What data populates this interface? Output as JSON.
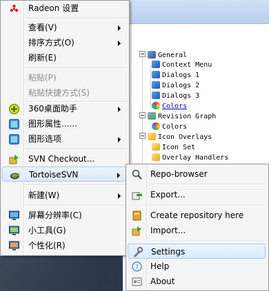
{
  "colors": {
    "menu_bg": "#f5f5f5",
    "menu_border": "#979797",
    "highlight_bg": "#d9eafc",
    "highlight_border": "#a8cbf1",
    "disabled_text": "#8d8d8d",
    "link_text": "#0000cc"
  },
  "settings_tree": {
    "items": [
      {
        "label": "General",
        "icon": "wrench-icon"
      },
      {
        "label": "Context Menu",
        "icon": "puzzle-icon"
      },
      {
        "label": "Dialogs 1",
        "icon": "puzzle-icon"
      },
      {
        "label": "Dialogs 2",
        "icon": "puzzle-icon"
      },
      {
        "label": "Dialogs 3",
        "icon": "puzzle-icon"
      },
      {
        "label": "Colors",
        "icon": "palette-icon"
      },
      {
        "label": "Revision Graph",
        "icon": "graph-icon"
      },
      {
        "label": "Colors",
        "icon": "palette-icon"
      },
      {
        "label": "Icon Overlays",
        "icon": "overlay-icon"
      },
      {
        "label": "Icon Set",
        "icon": "overlay-icon"
      },
      {
        "label": "Overlay Handlers",
        "icon": "overlay-icon"
      }
    ]
  },
  "context_menu": {
    "items": [
      {
        "label": "Radeon 设置",
        "icon": "radeon-icon",
        "disabled": false,
        "submenu": false
      },
      {
        "label": "查看(V)",
        "disabled": false,
        "submenu": true
      },
      {
        "label": "排序方式(O)",
        "disabled": false,
        "submenu": true
      },
      {
        "label": "刷新(E)",
        "disabled": false,
        "submenu": false
      },
      {
        "label": "粘贴(P)",
        "disabled": true,
        "submenu": false
      },
      {
        "label": "粘贴快捷方式(S)",
        "disabled": true,
        "submenu": false
      },
      {
        "label": "360桌面助手",
        "icon": "360-icon",
        "disabled": false,
        "submenu": true
      },
      {
        "label": "图形属性......",
        "icon": "graphics-properties-icon",
        "disabled": false,
        "submenu": false
      },
      {
        "label": "图形选项",
        "icon": "graphics-options-icon",
        "disabled": false,
        "submenu": true
      },
      {
        "label": "SVN Checkout...",
        "icon": "svn-checkout-icon",
        "disabled": false,
        "submenu": false
      },
      {
        "label": "TortoiseSVN",
        "icon": "tortoisesvn-icon",
        "disabled": false,
        "submenu": true,
        "highlighted": true
      },
      {
        "label": "新建(W)",
        "disabled": false,
        "submenu": true
      },
      {
        "label": "屏幕分辨率(C)",
        "icon": "screen-resolution-icon",
        "disabled": false,
        "submenu": false
      },
      {
        "label": "小工具(G)",
        "icon": "gadgets-icon",
        "disabled": false,
        "submenu": false
      },
      {
        "label": "个性化(R)",
        "icon": "personalize-icon",
        "disabled": false,
        "submenu": false
      }
    ]
  },
  "tortoisesvn_submenu": {
    "items": [
      {
        "label": "Repo-browser",
        "icon": "repo-browser-icon"
      },
      {
        "label": "Export...",
        "icon": "export-icon"
      },
      {
        "label": "Create repository here",
        "icon": "create-repository-icon"
      },
      {
        "label": "Import...",
        "icon": "import-icon"
      },
      {
        "label": "Settings",
        "icon": "settings-icon",
        "highlighted": true
      },
      {
        "label": "Help",
        "icon": "help-icon"
      },
      {
        "label": "About",
        "icon": "about-icon"
      }
    ]
  }
}
